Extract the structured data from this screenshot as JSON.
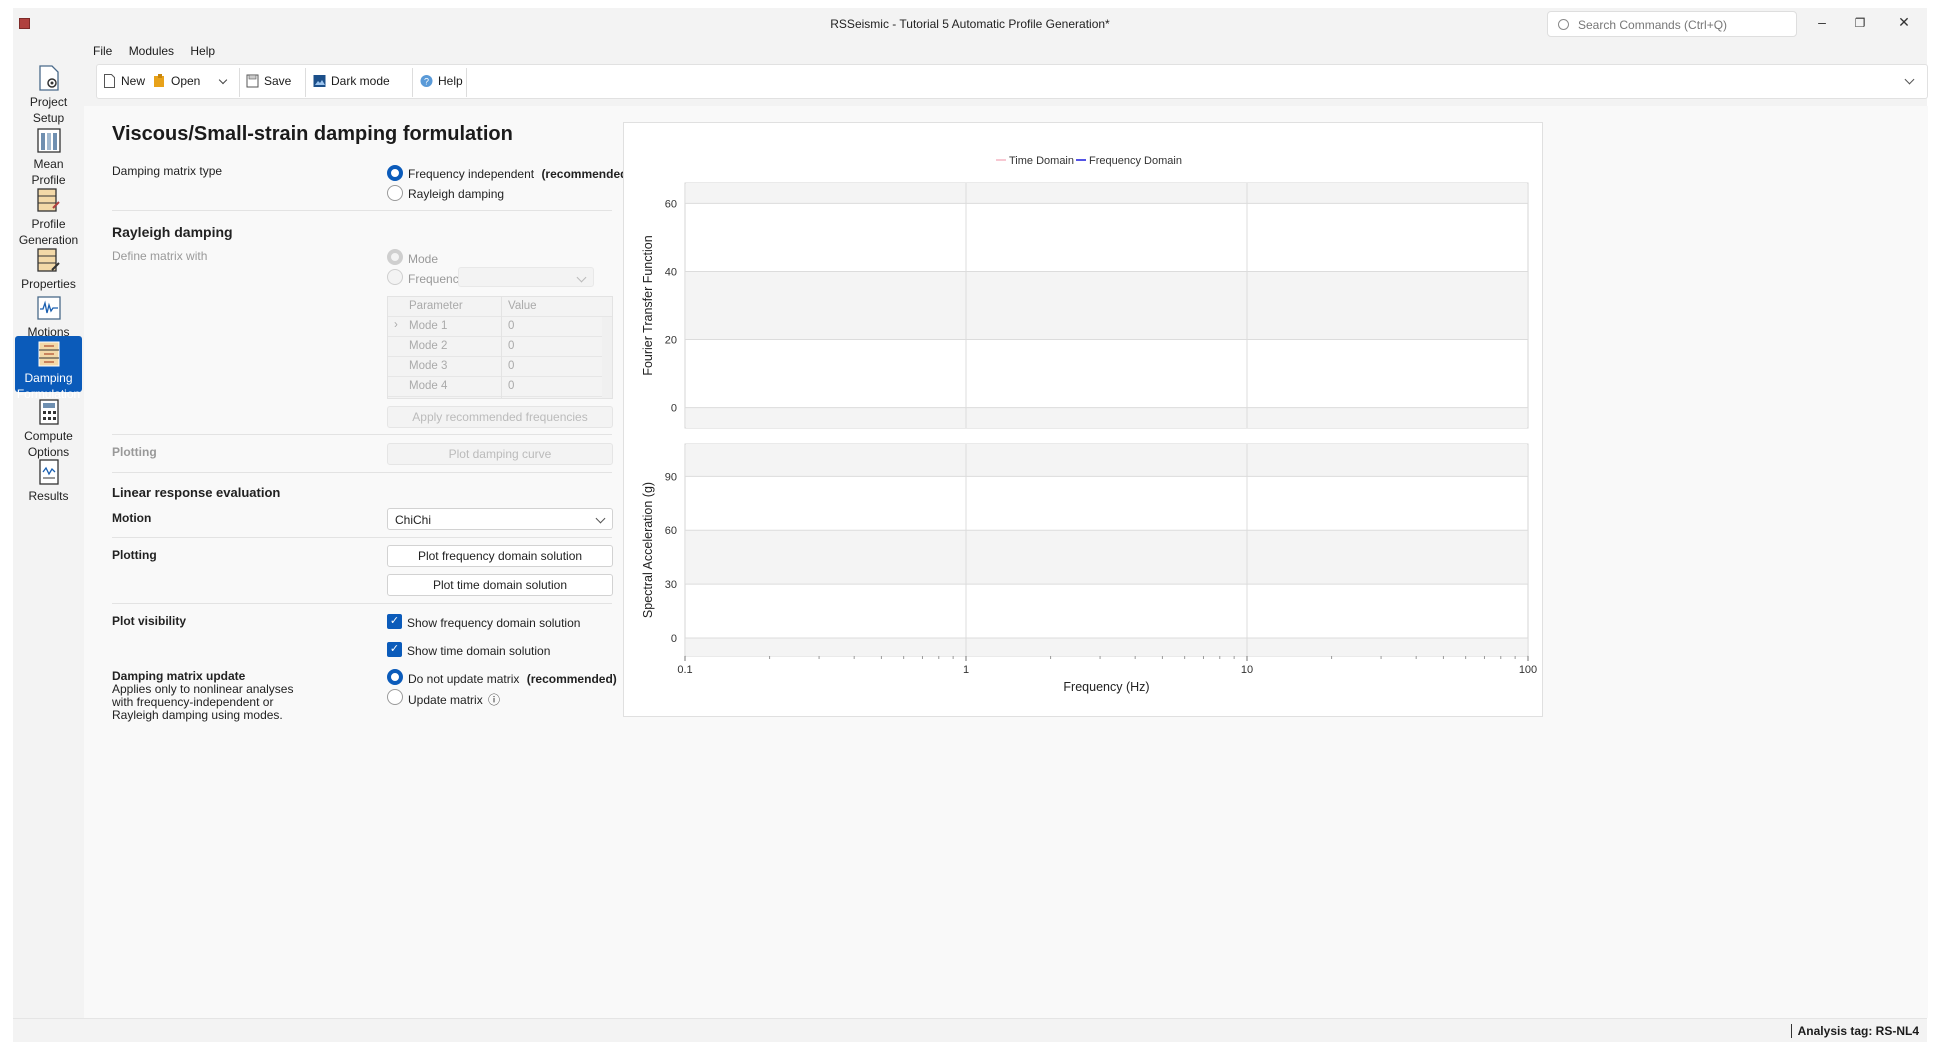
{
  "window": {
    "title": "RSSeismic - Tutorial 5 Automatic Profile Generation*",
    "search_placeholder": "Search Commands (Ctrl+Q)",
    "minimize": "–",
    "restore": "❐",
    "close": "✕"
  },
  "menu": {
    "file": "File",
    "modules": "Modules",
    "help": "Help"
  },
  "toolbar": {
    "new": "New",
    "open": "Open",
    "save": "Save",
    "dark_mode": "Dark mode",
    "help": "Help"
  },
  "nav": {
    "project_setup_1": "Project",
    "project_setup_2": "Setup",
    "mean_profile_1": "Mean",
    "mean_profile_2": "Profile",
    "profile_generation_1": "Profile",
    "profile_generation_2": "Generation",
    "properties": "Properties",
    "motions": "Motions",
    "damping_1": "Damping",
    "damping_2": "Formulation",
    "compute_1": "Compute",
    "compute_2": "Options",
    "results": "Results"
  },
  "panel": {
    "title": "Viscous/Small-strain damping formulation",
    "damping_matrix_type_label": "Damping matrix type",
    "freq_independent": "Frequency independent",
    "recommended": "(recommended)",
    "rayleigh_damping": "Rayleigh damping",
    "rayleigh_section": "Rayleigh damping",
    "define_matrix_label": "Define matrix with",
    "mode": "Mode",
    "frequency": "Frequency",
    "table_headers": {
      "parameter": "Parameter",
      "value": "Value"
    },
    "table_rows": [
      {
        "param": "Mode 1",
        "value": "0"
      },
      {
        "param": "Mode 2",
        "value": "0"
      },
      {
        "param": "Mode 3",
        "value": "0"
      },
      {
        "param": "Mode 4",
        "value": "0"
      }
    ],
    "apply_recommended": "Apply recommended frequencies",
    "plotting_label": "Plotting",
    "plot_damping_curve": "Plot damping curve",
    "linear_response_section": "Linear response evaluation",
    "motion_label": "Motion",
    "motion_value": "ChiChi",
    "plotting_label2": "Plotting",
    "plot_freq_solution": "Plot frequency domain solution",
    "plot_time_solution": "Plot time domain solution",
    "plot_visibility_label": "Plot visibility",
    "show_freq_solution": "Show frequency domain solution",
    "show_time_solution": "Show time domain solution",
    "damping_update_label": "Damping matrix update",
    "damping_update_desc_1": "Applies only to nonlinear analyses",
    "damping_update_desc_2": "with frequency-independent or",
    "damping_update_desc_3": "Rayleigh damping using modes.",
    "do_not_update": "Do not update matrix",
    "recommended2": "(recommended)",
    "update_matrix": "Update matrix",
    "info_glyph": "ⓘ"
  },
  "status": {
    "analysis_tag": "Analysis tag: RS-NL4"
  },
  "colors": {
    "accent": "#0b5bba",
    "time_domain": "#f4b6c2",
    "frequency_domain": "#1a1adc"
  },
  "chart_data": {
    "type": "line",
    "legend": [
      "Time Domain",
      "Frequency Domain"
    ],
    "legend_placement": "top-center",
    "xlabel": "Frequency (Hz)",
    "x_scale": "log",
    "xlim": [
      0.1,
      100
    ],
    "x_ticks": [
      "0.1",
      "1",
      "10",
      "100"
    ],
    "panels": [
      {
        "ylabel": "Fourier Transfer Function",
        "ylim": [
          -6,
          66
        ],
        "y_ticks": [
          0,
          20,
          40,
          60
        ],
        "series": []
      },
      {
        "ylabel": "Spectral Acceleration (g)",
        "ylim": [
          -10,
          108
        ],
        "y_ticks": [
          0,
          30,
          60,
          90
        ],
        "series": []
      }
    ],
    "grid": true
  }
}
